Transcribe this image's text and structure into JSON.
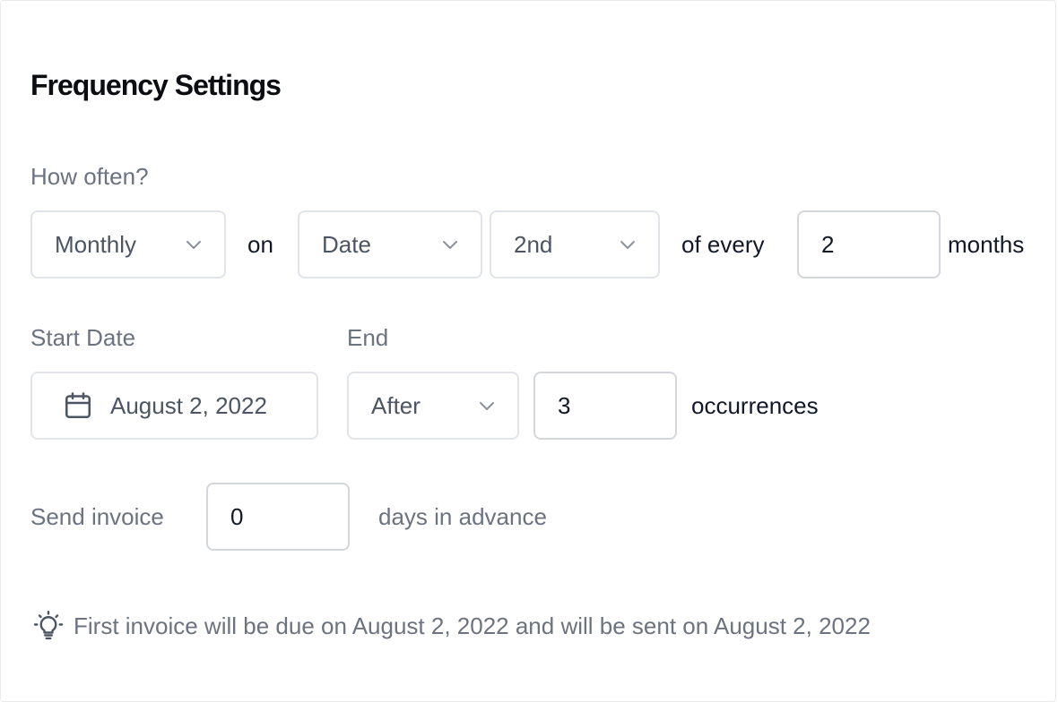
{
  "section": {
    "title": "Frequency Settings"
  },
  "frequency": {
    "label": "How often?",
    "period_select": "Monthly",
    "on_text": "on",
    "day_type_select": "Date",
    "day_select": "2nd",
    "of_every_text": "of every",
    "interval_value": "2",
    "unit_text": "months"
  },
  "start": {
    "label": "Start Date",
    "value": "August 2, 2022"
  },
  "end": {
    "label": "End",
    "mode_select": "After",
    "count_value": "3",
    "unit_text": "occurrences"
  },
  "send": {
    "label": "Send invoice",
    "days_value": "0",
    "suffix_text": "days in advance"
  },
  "hint": {
    "text": "First invoice will be due on August 2, 2022 and will be sent on August 2, 2022"
  },
  "icons": {
    "chevron": "chevron-down-icon",
    "calendar": "calendar-icon",
    "hint": "lightbulb-icon"
  },
  "colors": {
    "border": "#e1e4ea",
    "label": "#6b7280",
    "text": "#111827"
  }
}
